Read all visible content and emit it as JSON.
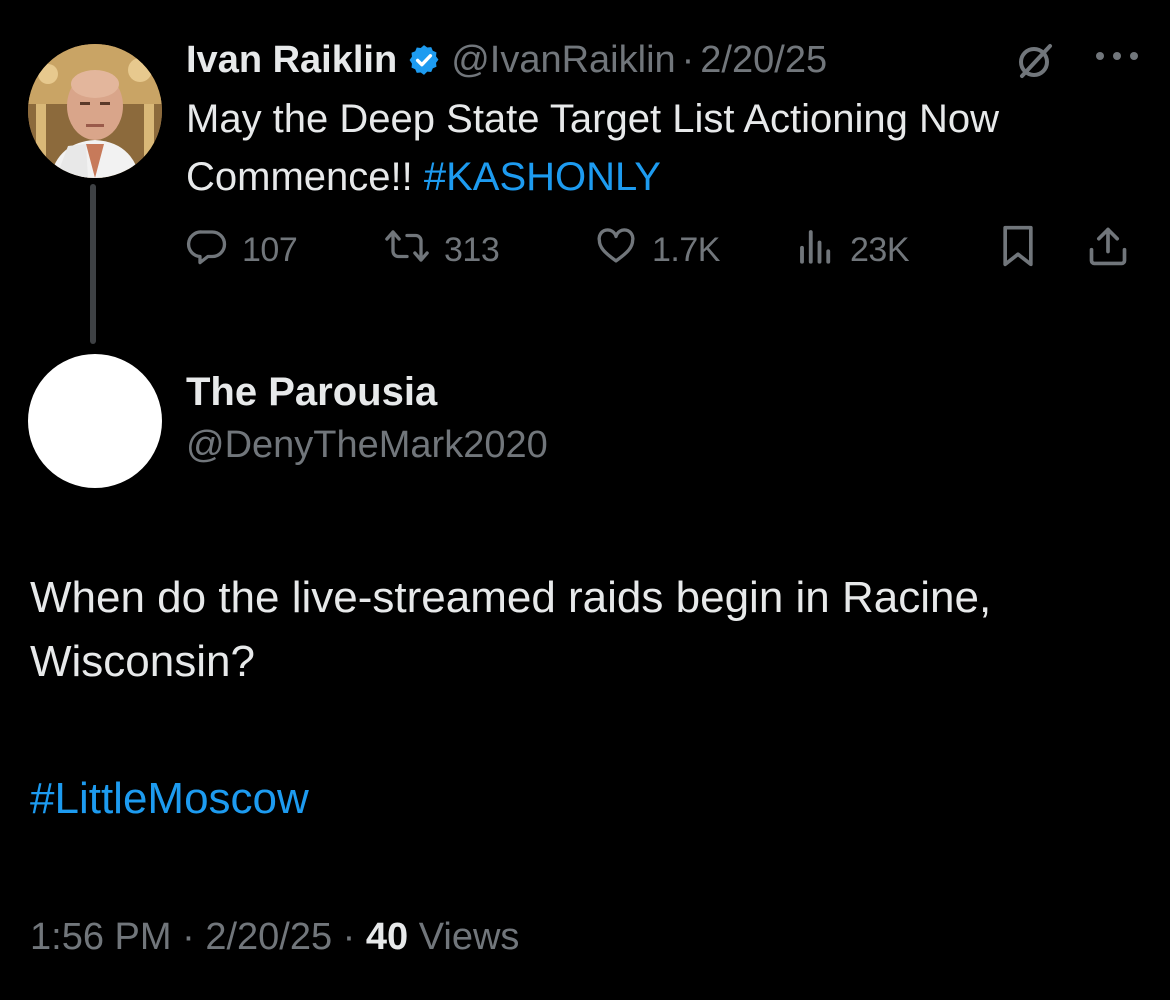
{
  "parent_tweet": {
    "author_name": "Ivan Raiklin",
    "handle": "@IvanRaiklin",
    "separator": "·",
    "date": "2/20/25",
    "text": "May the Deep State Target List Actioning Now Commence!! ",
    "hashtag": "#KASHONLY",
    "replies": "107",
    "reposts": "313",
    "likes": "1.7K",
    "views": "23K",
    "icons": [
      "verified-badge-icon",
      "grok-icon",
      "more-icon",
      "reply-icon",
      "repost-icon",
      "like-icon",
      "views-icon",
      "bookmark-icon",
      "share-icon"
    ]
  },
  "reply_tweet": {
    "author_name": "The Parousia",
    "handle": "@DenyTheMark2020",
    "text": "When do the live-streamed raids begin in Racine, Wisconsin?",
    "hashtag": "#LittleMoscow",
    "time": "1:56 PM",
    "separator": "·",
    "date": "2/20/25",
    "views_count": "40",
    "views_label": "Views"
  },
  "colors": {
    "background": "#000000",
    "text_primary": "#e7e9ea",
    "text_muted": "#71767b",
    "link": "#1d9bf0",
    "verified": "#1d9bf0"
  }
}
